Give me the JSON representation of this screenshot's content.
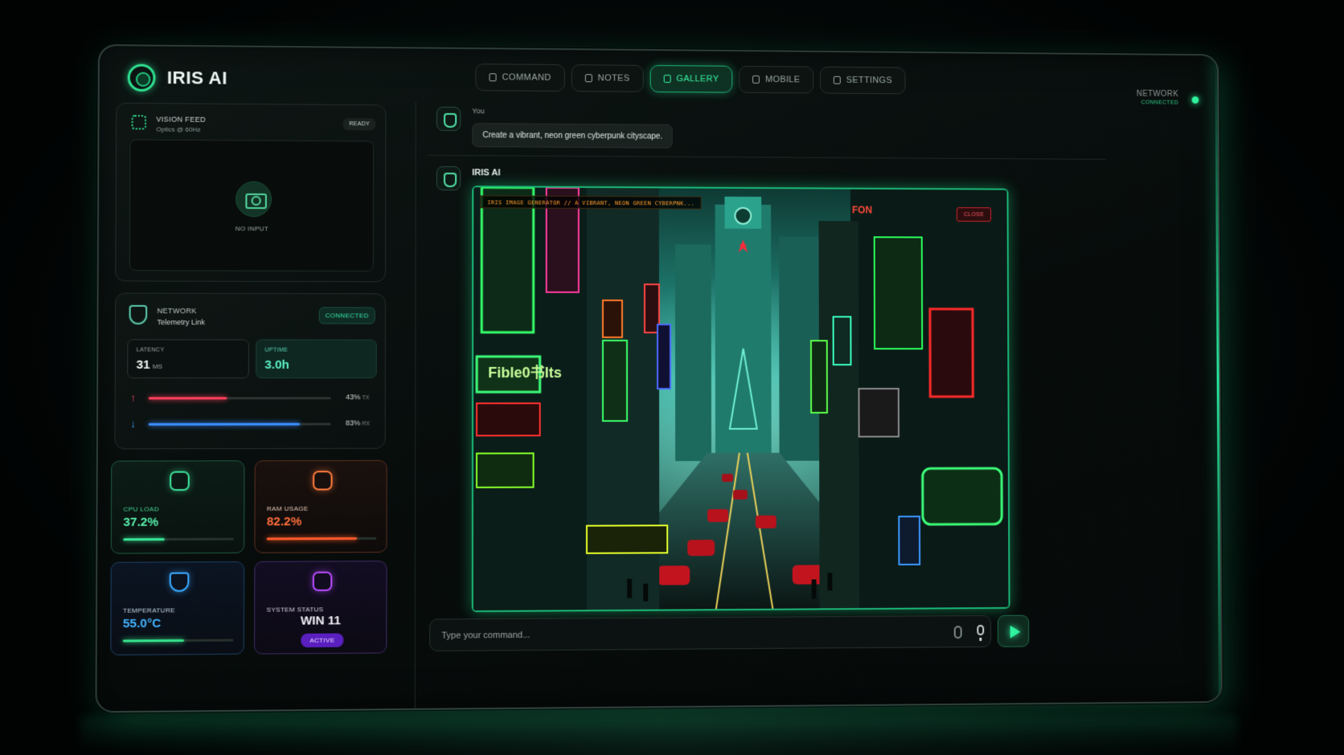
{
  "app": {
    "title": "IRIS AI"
  },
  "tabs": [
    {
      "label": "COMMAND",
      "active": false
    },
    {
      "label": "NOTES",
      "active": false
    },
    {
      "label": "GALLERY",
      "active": true
    },
    {
      "label": "MOBILE",
      "active": false
    },
    {
      "label": "SETTINGS",
      "active": false
    }
  ],
  "header_status": {
    "label": "NETWORK",
    "state": "CONNECTED",
    "dot_color": "#2ef29c"
  },
  "vision_feed": {
    "title": "VISION FEED",
    "subtitle": "Optics @ 60Hz",
    "badge": "READY",
    "placeholder": "NO INPUT",
    "icon": "camera-icon"
  },
  "network": {
    "title": "NETWORK",
    "subtitle": "Telemetry Link",
    "badge": "CONNECTED",
    "latency": {
      "label": "LATENCY",
      "value": "31",
      "unit": "MS"
    },
    "uptime": {
      "label": "UPTIME",
      "value": "3.0h"
    },
    "tx": {
      "percent": "43%",
      "unit": "TX",
      "fraction": 0.43,
      "color": "#ff3f5c"
    },
    "rx": {
      "percent": "83%",
      "unit": "RX",
      "fraction": 0.83,
      "color": "#3a8dff"
    }
  },
  "stats": {
    "cpu": {
      "label": "CPU LOAD",
      "value": "37.2%",
      "fraction": 0.372,
      "color": "#3ce09a"
    },
    "ram": {
      "label": "RAM USAGE",
      "value": "82.2%",
      "fraction": 0.822,
      "color": "#ff6e3a"
    },
    "temperature": {
      "label": "TEMPERATURE",
      "value": "55.0°C",
      "fraction": 0.55,
      "color": "#44b3ff"
    },
    "system": {
      "label": "SYSTEM STATUS",
      "value": "WIN 11",
      "badge": "ACTIVE",
      "color": "#b84bff"
    }
  },
  "chat": {
    "user": {
      "name": "You",
      "message": "Create a vibrant, neon green cyberpunk cityscape."
    },
    "assistant": {
      "name": "IRIS AI"
    },
    "image": {
      "generator_label": "IRIS IMAGE GENERATOR // A VIBRANT, NEON GREEN CYBERPNK...",
      "close_label": "CLOSE",
      "sign_texts": [
        "FON",
        "Fible0书lts"
      ]
    },
    "composer": {
      "placeholder": "Type your command..."
    }
  }
}
